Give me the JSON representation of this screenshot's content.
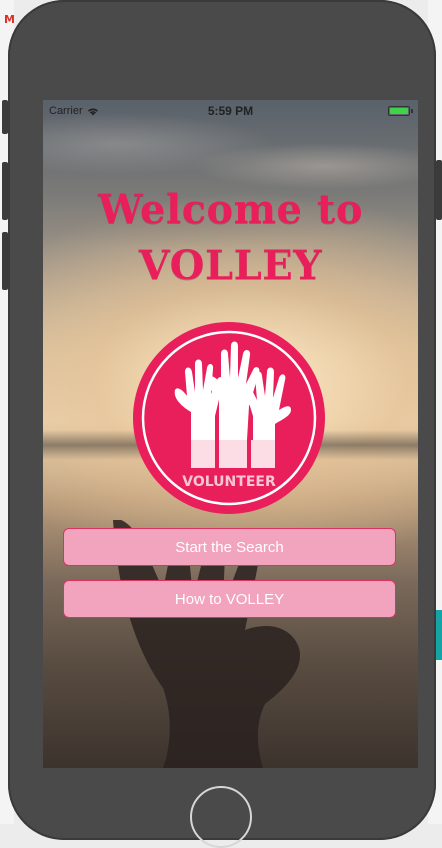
{
  "status_bar": {
    "carrier": "Carrier",
    "time": "5:59 PM",
    "battery_color": "#3fd24a"
  },
  "welcome": {
    "line1": "Welcome to",
    "line2": "VOLLEY"
  },
  "logo": {
    "label": "VOLUNTEER",
    "color": "#e81f5a"
  },
  "buttons": {
    "start_search": "Start the Search",
    "how_to": "How to VOLLEY"
  },
  "colors": {
    "accent": "#e81f5a",
    "button_fill": "#f2a3bd",
    "button_border": "#d9335f"
  },
  "desktop": {
    "gmail_mark": "M"
  }
}
